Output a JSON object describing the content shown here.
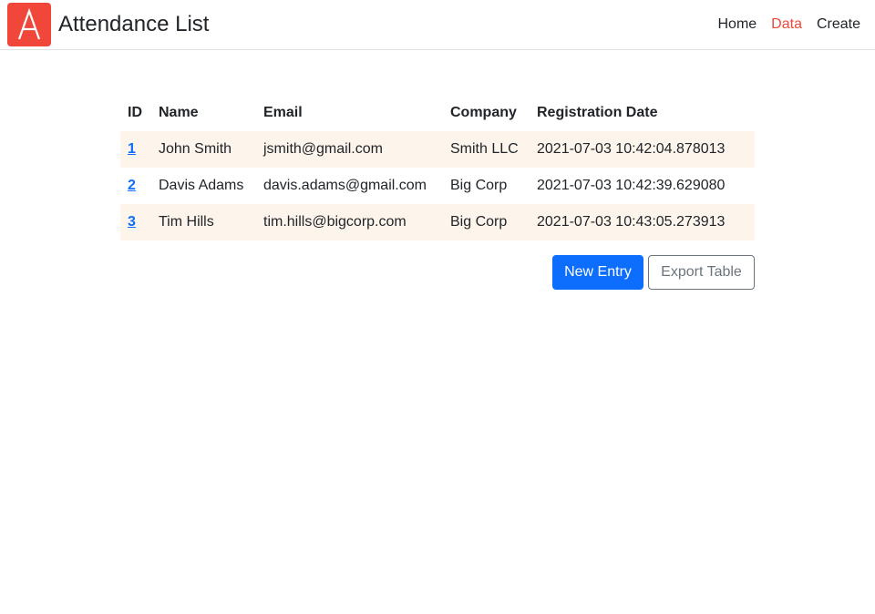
{
  "navbar": {
    "title": "Attendance List",
    "logo_letter": "A",
    "links": {
      "home": "Home",
      "data": "Data",
      "create": "Create"
    }
  },
  "table": {
    "headers": {
      "id": "ID",
      "name": "Name",
      "email": "Email",
      "company": "Company",
      "registration_date": "Registration Date"
    },
    "rows": [
      {
        "id": "1",
        "name": "John Smith",
        "email": "jsmith@gmail.com",
        "company": "Smith LLC",
        "registration_date": "2021-07-03 10:42:04.878013"
      },
      {
        "id": "2",
        "name": "Davis Adams",
        "email": "davis.adams@gmail.com",
        "company": "Big Corp",
        "registration_date": "2021-07-03 10:42:39.629080"
      },
      {
        "id": "3",
        "name": "Tim Hills",
        "email": "tim.hills@bigcorp.com",
        "company": "Big Corp",
        "registration_date": "2021-07-03 10:43:05.273913"
      }
    ]
  },
  "actions": {
    "new_entry": "New Entry",
    "export_table": "Export Table"
  },
  "colors": {
    "brand": "#f0473a",
    "primary": "#0d6efd",
    "row_stripe": "#fdf4ec"
  }
}
